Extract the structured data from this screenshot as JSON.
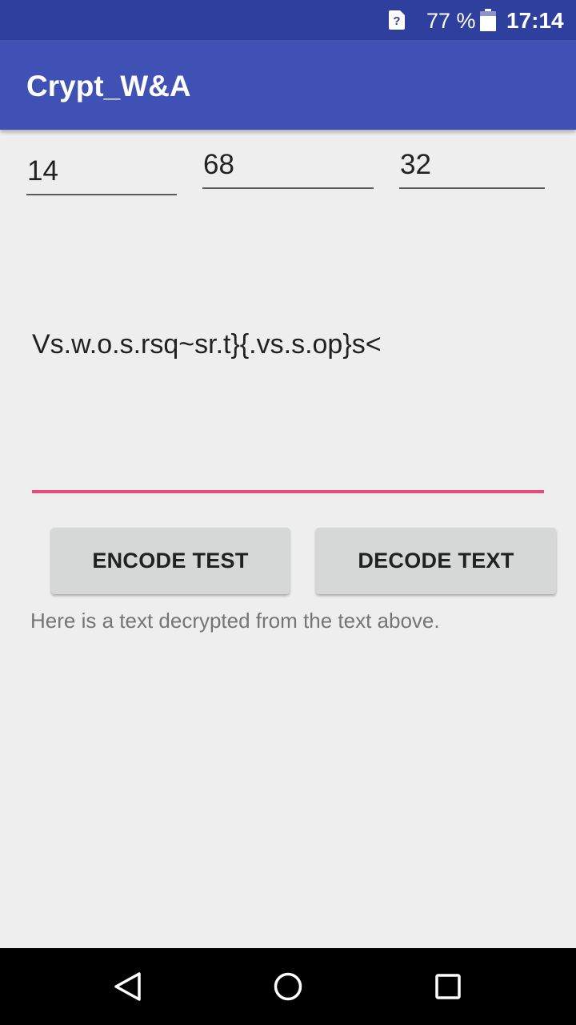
{
  "status_bar": {
    "battery_percent": "77 %",
    "time": "17:14",
    "icons": [
      "sim-unknown-icon",
      "battery-icon"
    ]
  },
  "app_bar": {
    "title": "Crypt_W&A"
  },
  "inputs": {
    "key1": "14",
    "key2": "68",
    "key3": "32"
  },
  "cipher": {
    "text": "Vs.w.o.s.rsq~sr.t}{.vs.s.op}s<"
  },
  "buttons": {
    "encode_label": "ENCODE TEST",
    "decode_label": "DECODE TEXT"
  },
  "hint": {
    "text": "Here is a text decrypted from the text above."
  },
  "colors": {
    "status_bar": "#2f3f9e",
    "app_bar": "#3f51b5",
    "accent": "#e94a7c",
    "background": "#eeeeee"
  },
  "nav": {
    "icons": [
      "back-icon",
      "home-icon",
      "recent-apps-icon"
    ]
  }
}
